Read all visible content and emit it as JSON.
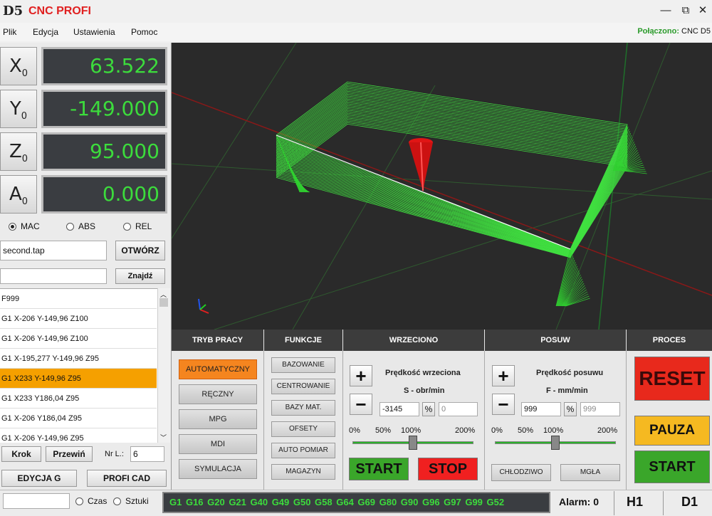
{
  "app": {
    "logo": "D5",
    "title": "CNC PROFI",
    "min": "—",
    "max": "⧉",
    "close": "✕"
  },
  "menu": [
    "Plik",
    "Edycja",
    "Ustawienia",
    "Pomoc"
  ],
  "connection": {
    "label": "Połączono:",
    "value": "CNC D5"
  },
  "axes": [
    {
      "name": "X",
      "sub": "0",
      "value": "63.522"
    },
    {
      "name": "Y",
      "sub": "0",
      "value": "-149.000"
    },
    {
      "name": "Z",
      "sub": "0",
      "value": "95.000"
    },
    {
      "name": "A",
      "sub": "0",
      "value": "0.000"
    }
  ],
  "coord_modes": [
    {
      "label": "MAC",
      "selected": true
    },
    {
      "label": "ABS",
      "selected": false
    },
    {
      "label": "REL",
      "selected": false
    }
  ],
  "file": {
    "name": "second.tap",
    "open_label": "OTWÓRZ",
    "search_value": "",
    "find_label": "Znajdź"
  },
  "gcode_lines": [
    "F999",
    "G1 X-206 Y-149,96 Z100",
    "G1 X-206 Y-149,96 Z100",
    "G1 X-195,277 Y-149,96 Z95",
    "G1 X233 Y-149,96 Z95",
    "G1 X233 Y186,04 Z95",
    "G1 X-206 Y186,04 Z95",
    "G1 X-206 Y-149,96 Z95"
  ],
  "selected_line": 4,
  "step": {
    "krok": "Krok",
    "przewin": "Przewiń",
    "nrl_label": "Nr L.:",
    "nrl_value": "6"
  },
  "edit": {
    "edycja": "EDYCJA G",
    "cad": "PROFI CAD"
  },
  "sections": {
    "tryb": "TRYB PRACY",
    "funkcje": "FUNKCJE",
    "wrzeciono": "WRZECIONO",
    "posuw": "POSUW",
    "proces": "PROCES"
  },
  "modes": [
    "AUTOMATYCZNY",
    "RĘCZNY",
    "MPG",
    "MDI",
    "SYMULACJA"
  ],
  "active_mode": 0,
  "functions": [
    "BAZOWANIE",
    "CENTROWANIE",
    "BAZY MAT.",
    "OFSETY",
    "AUTO POMIAR",
    "MAGAZYN"
  ],
  "spindle": {
    "title": "Prędkość wrzeciona",
    "unit": "S - obr/min",
    "value": "-3145",
    "pct": "%",
    "pct_value": "0",
    "plus": "+",
    "minus": "−",
    "ticks": [
      "0%",
      "50%",
      "100%",
      "200%"
    ],
    "level_percent": 100,
    "start": "START",
    "stop": "STOP"
  },
  "feed": {
    "title": "Prędkość posuwu",
    "unit": "F - mm/min",
    "value": "999",
    "pct": "%",
    "pct_value": "999",
    "plus": "+",
    "minus": "−",
    "ticks": [
      "0%",
      "50%",
      "100%",
      "200%"
    ],
    "level_percent": 100,
    "chlodziwo": "CHŁODZIWO",
    "mgla": "MGŁA"
  },
  "process": {
    "reset": "RESET",
    "pauza": "PAUZA",
    "start": "START"
  },
  "status": {
    "czas": "Czas",
    "sztuki": "Sztuki",
    "gcodes": "G1  G16  G20  G21  G40  G49  G50  G58  G64 G69  G80  G90  G96  G97  G99  G52",
    "alarm": "Alarm: 0",
    "h": "H1",
    "d": "D1"
  },
  "colors": {
    "accent_green": "#3cdc3c",
    "orange": "#f5851f",
    "reset_red": "#e8291c",
    "pause_yellow": "#f5b921",
    "start_green": "#3aa62a",
    "stop_red": "#f02020"
  }
}
